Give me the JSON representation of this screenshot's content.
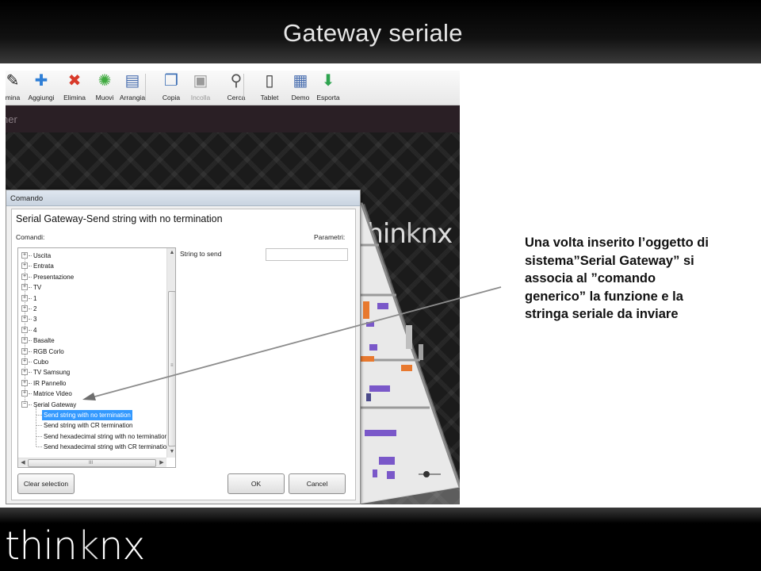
{
  "slide": {
    "title": "Gateway seriale",
    "description_lines": [
      "Una volta inserito l’oggetto di",
      "sistema”Serial Gateway” si",
      "associa al ”comando",
      "generico” la funzione e la",
      "stringa seriale da inviare"
    ],
    "footer_logo": {
      "pre": "thin",
      "k": "k",
      "post": "nx"
    }
  },
  "toolbar": {
    "items": [
      {
        "label": "mina",
        "icon": "pencil-icon",
        "enabled": true
      },
      {
        "label": "Aggiungi",
        "icon": "plus-icon",
        "enabled": true
      },
      {
        "label": "Elimina",
        "icon": "delete-x-icon",
        "enabled": true
      },
      {
        "label": "Muovi",
        "icon": "move-icon",
        "enabled": true
      },
      {
        "label": "Arrangia",
        "icon": "arrange-icon",
        "enabled": true
      },
      {
        "label": "Copia",
        "icon": "copy-icon",
        "enabled": true
      },
      {
        "label": "Incolla",
        "icon": "paste-icon",
        "enabled": false
      },
      {
        "label": "Cerca",
        "icon": "search-icon",
        "enabled": true
      },
      {
        "label": "Tablet",
        "icon": "tablet-icon",
        "enabled": true
      },
      {
        "label": "Demo",
        "icon": "demo-icon",
        "enabled": true
      },
      {
        "label": "Esporta",
        "icon": "export-icon",
        "enabled": true
      }
    ]
  },
  "app": {
    "darkbar_text": "ner",
    "canvas_logo": {
      "pre": "thin",
      "k": "k",
      "post": "nx"
    }
  },
  "dialog": {
    "title": "Comando",
    "heading": "Serial Gateway-Send string with no termination",
    "comandi_label": "Comandi:",
    "parametri_label": "Parametri:",
    "string_to_send_label": "String to send",
    "string_to_send_value": "",
    "tree": [
      "Uscita",
      "Entrata",
      "Presentazione",
      "TV",
      "1",
      "2",
      "3",
      "4",
      "Basalte",
      "RGB Corlo",
      "Cubo",
      "TV Samsung",
      "IR Pannello",
      "Matrice Video",
      "Serial Gateway"
    ],
    "tree_expanded": "Serial Gateway",
    "subitems": [
      "Send string with no termination",
      "Send string with CR termination",
      "Send hexadecimal string with no termination",
      "Send hexadecimal string with CR termination"
    ],
    "selected_subitem": "Send string with no termination",
    "hscroll_grip": "III",
    "buttons": {
      "clear": "Clear selection",
      "ok": "OK",
      "cancel": "Cancel"
    }
  },
  "colors": {
    "selection": "#3399ff",
    "title_text": "#e6e6e6",
    "header_bg": "#000000"
  }
}
